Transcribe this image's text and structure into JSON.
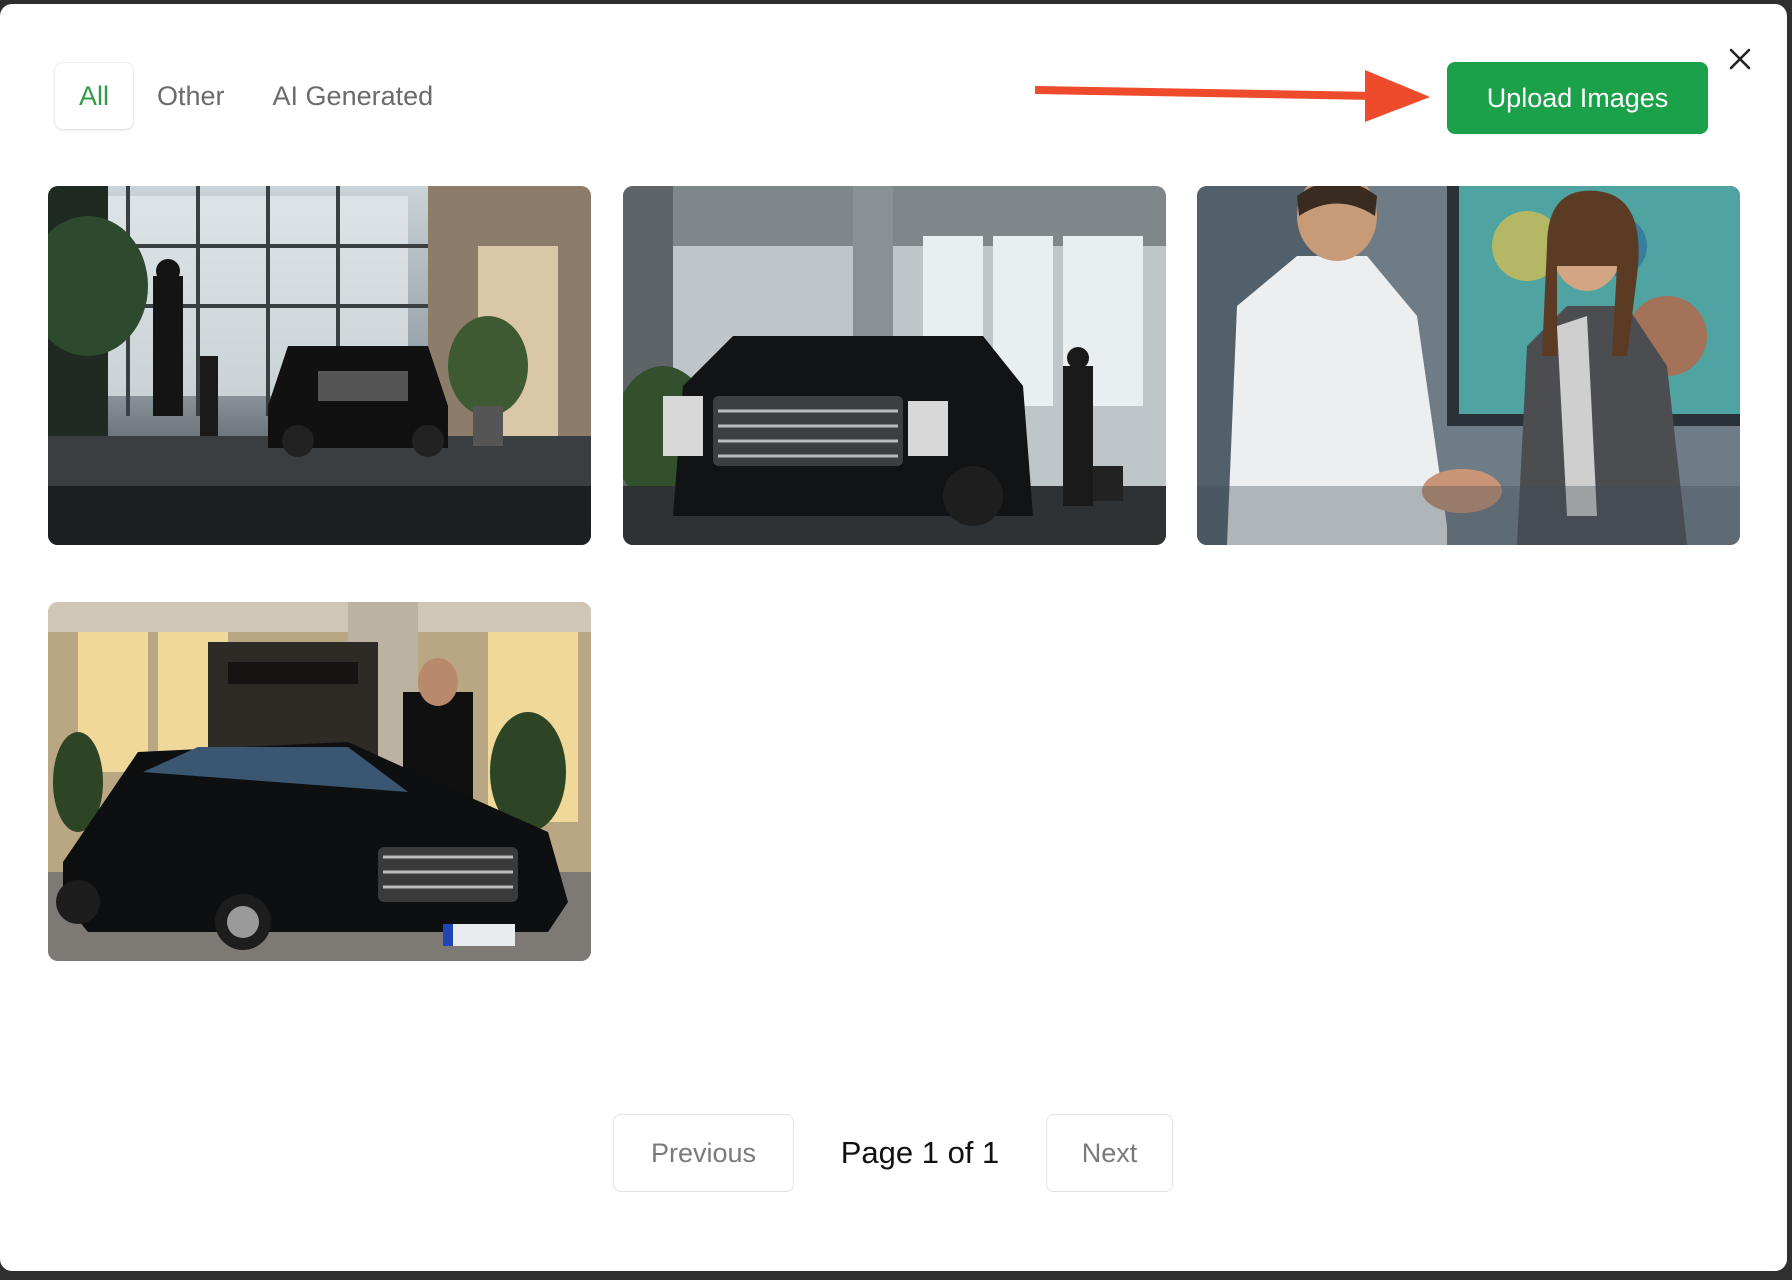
{
  "tabs": [
    {
      "label": "All",
      "active": true
    },
    {
      "label": "Other",
      "active": false
    },
    {
      "label": "AI Generated",
      "active": false
    }
  ],
  "toolbar": {
    "upload_label": "Upload Images",
    "close_icon": "close-icon",
    "arrow_icon": "arrow-right-icon"
  },
  "gallery": {
    "images": [
      {
        "name": "image-car-lobby"
      },
      {
        "name": "image-suv-lobby"
      },
      {
        "name": "image-handshake"
      },
      {
        "name": "image-sedan-entrance"
      }
    ]
  },
  "pagination": {
    "previous_label": "Previous",
    "page_label": "Page 1 of 1",
    "next_label": "Next"
  },
  "colors": {
    "accent_green": "#1aa14a",
    "active_tab": "#2e9b47",
    "arrow_red": "#ee4a2c"
  }
}
